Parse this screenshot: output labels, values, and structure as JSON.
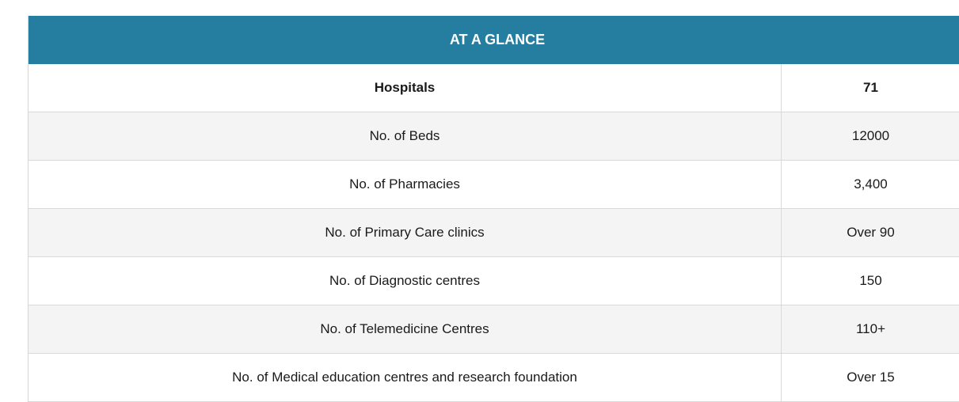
{
  "header": {
    "title": "AT A GLANCE"
  },
  "rows": [
    {
      "label": "Hospitals",
      "value": "71"
    },
    {
      "label": "No. of Beds",
      "value": "12000"
    },
    {
      "label": "No. of Pharmacies",
      "value": "3,400"
    },
    {
      "label": "No. of Primary Care clinics",
      "value": "Over 90"
    },
    {
      "label": "No. of Diagnostic centres",
      "value": "150"
    },
    {
      "label": "No. of Telemedicine Centres",
      "value": "110+"
    },
    {
      "label": "No. of Medical education centres and research foundation",
      "value": "Over 15"
    }
  ],
  "colors": {
    "header_bg": "#257ea0",
    "header_text": "#ffffff",
    "row_alt_bg": "#f5f4f4",
    "border": "#d9d9d9"
  }
}
